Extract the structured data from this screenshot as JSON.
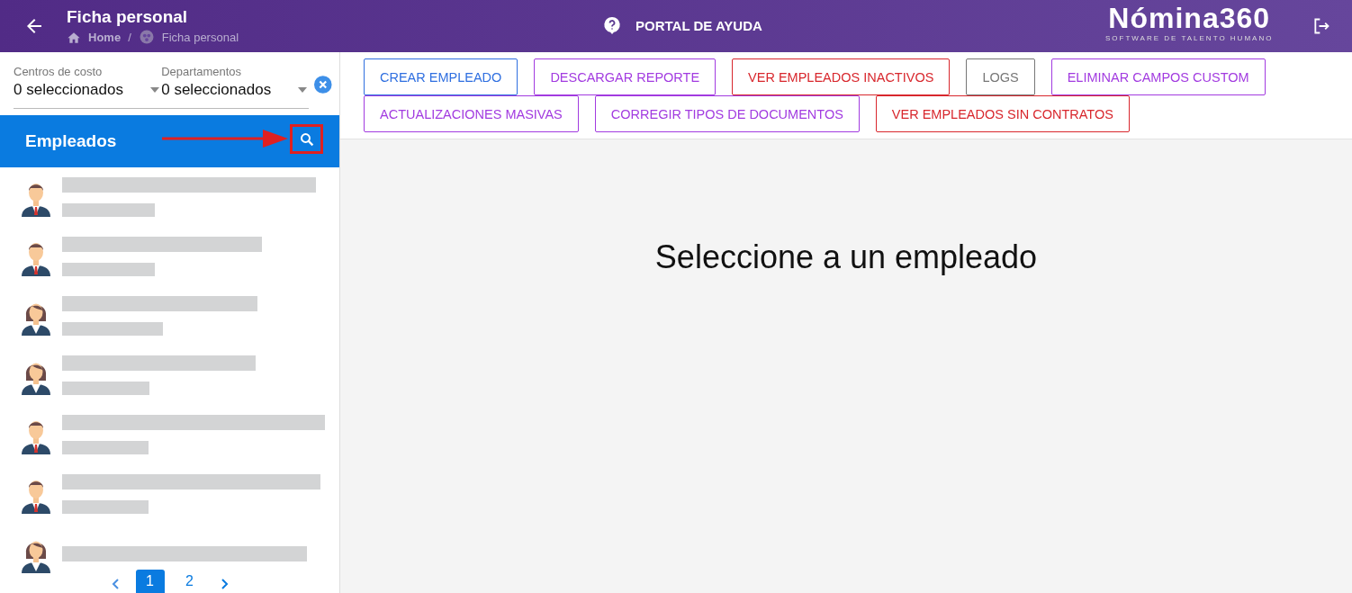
{
  "header": {
    "title": "Ficha personal",
    "breadcrumb": [
      "Home",
      "Ficha personal"
    ],
    "breadcrumb_separator": "/",
    "help_link": "PORTAL DE AYUDA",
    "logo": {
      "name": "Nómina360",
      "tagline": "SOFTWARE DE TALENTO HUMANO"
    }
  },
  "filters": [
    {
      "label": "Centros de costo",
      "value": "0 seleccionados"
    },
    {
      "label": "Departamentos",
      "value": "0 seleccionados"
    }
  ],
  "employees_panel": {
    "title": "Empleados",
    "employees": [
      {
        "kind": "male"
      },
      {
        "kind": "male"
      },
      {
        "kind": "female"
      },
      {
        "kind": "female"
      },
      {
        "kind": "male"
      },
      {
        "kind": "male"
      },
      {
        "kind": "female"
      }
    ],
    "pages": [
      {
        "label": "1",
        "selected": true
      },
      {
        "label": "2",
        "selected": false
      }
    ]
  },
  "actions": [
    {
      "label": "CREAR EMPLEADO",
      "color": "#2f6fe0"
    },
    {
      "label": "DESCARGAR REPORTE",
      "color": "#a23be0"
    },
    {
      "label": "VER EMPLEADOS INACTIVOS",
      "color": "#d8272d"
    },
    {
      "label": "LOGS",
      "color": "#777777"
    },
    {
      "label": "ELIMINAR CAMPOS CUSTOM",
      "color": "#a23be0"
    },
    {
      "label": "ACTUALIZACIONES MASIVAS",
      "color": "#a23be0"
    },
    {
      "label": "CORREGIR TIPOS DE DOCUMENTOS",
      "color": "#a23be0"
    },
    {
      "label": "VER EMPLEADOS SIN CONTRATOS",
      "color": "#d8272d"
    }
  ],
  "empty_message": "Seleccione a un empleado"
}
